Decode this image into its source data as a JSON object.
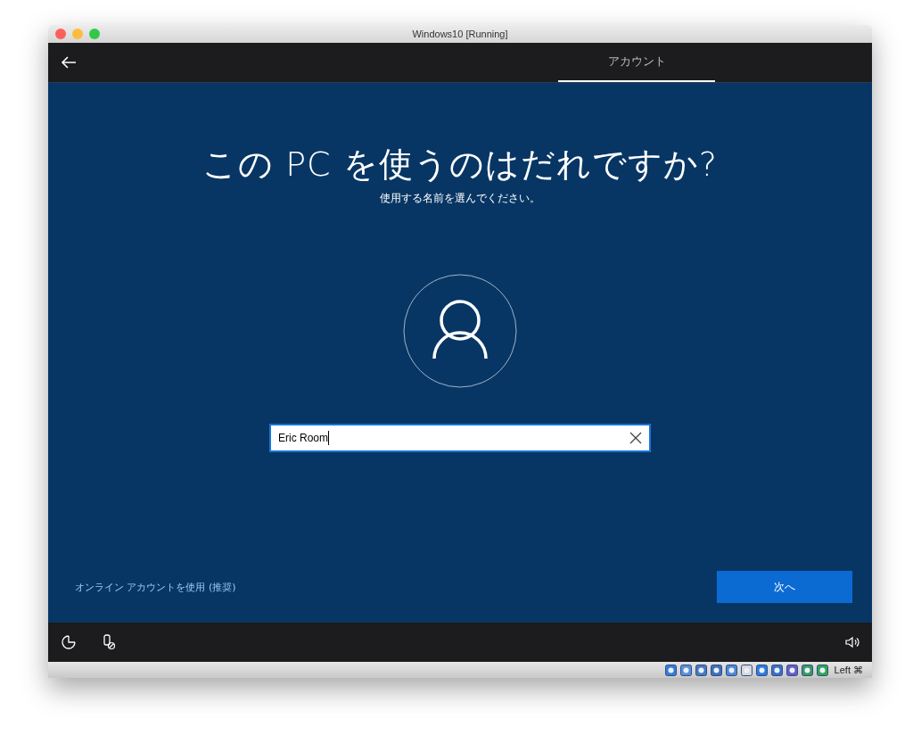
{
  "window": {
    "title": "Windows10 [Running]"
  },
  "top_bar": {
    "tabs": [
      {
        "label": "アカウント",
        "selected": true
      }
    ]
  },
  "heading": "この PC を使うのはだれですか?",
  "subheading": "使用する名前を選んでください。",
  "name_field": {
    "value": "Eric Room"
  },
  "online_account_link": "オンライン アカウントを使用 (推奨)",
  "next_button": "次へ",
  "status_bar": {
    "host_key": "Left ⌘"
  }
}
